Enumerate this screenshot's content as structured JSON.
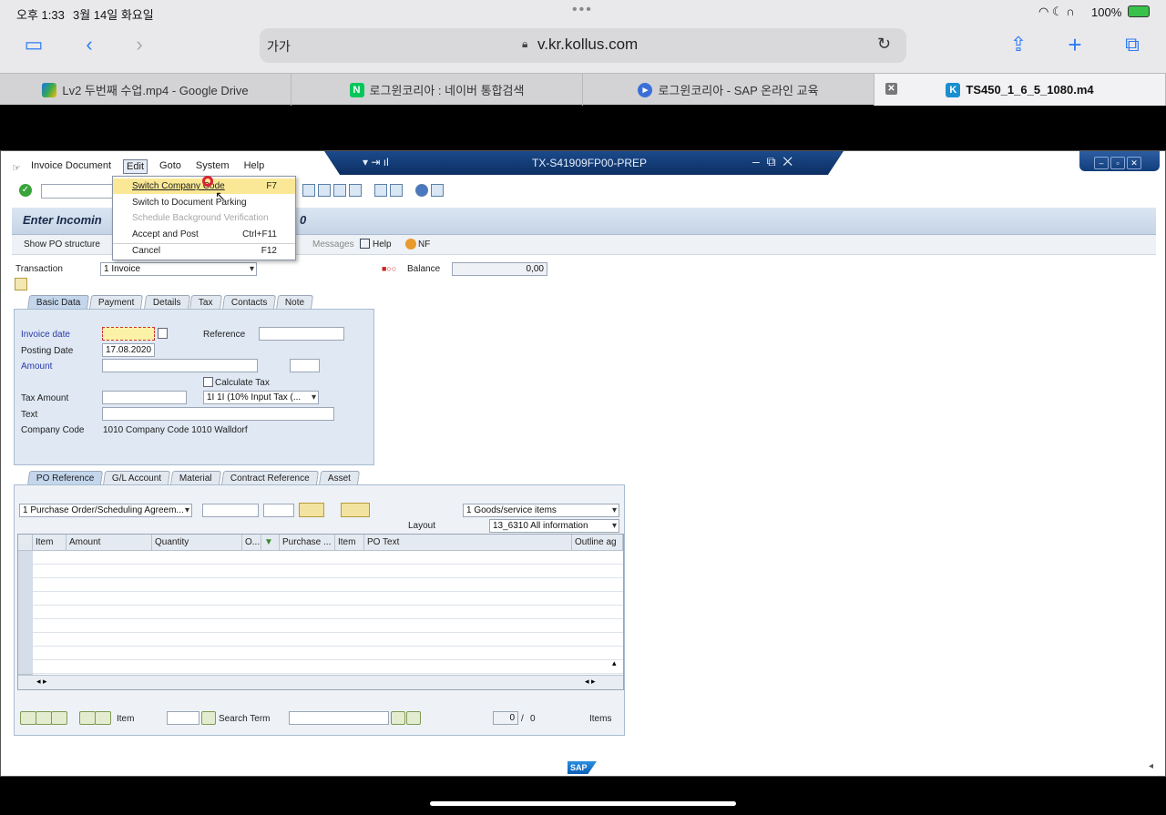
{
  "ipad": {
    "time": "오후 1:33",
    "date": "3월 14일 화요일",
    "battery": "100%",
    "aa_label": "가가",
    "url": "v.kr.kollus.com"
  },
  "browser_tabs": [
    {
      "label": "Lv2 두번째 수업.mp4 - Google Drive",
      "icon": "google-drive-icon"
    },
    {
      "label": "로그윈코리아 : 네이버 통합검색",
      "icon": "naver-icon"
    },
    {
      "label": "로그윈코리아 - SAP 온라인 교육",
      "icon": "play-icon"
    },
    {
      "label": "TS450_1_6_5_1080.m4",
      "icon": "kollus-icon"
    }
  ],
  "sap": {
    "menubar": [
      "Invoice Document",
      "Edit",
      "Goto",
      "System",
      "Help"
    ],
    "system_title": "TX-S41909FP00-PREP",
    "screen_title": "Enter Incomin",
    "screen_title_tail": "0",
    "app_toolbar": {
      "show_po": "Show PO structure",
      "messages": "Messages",
      "help": "Help",
      "nf": "NF"
    },
    "edit_menu": [
      {
        "label": "Switch Company Code",
        "shortcut": "F7"
      },
      {
        "label": "Switch to Document Parking",
        "shortcut": ""
      },
      {
        "label": "Schedule Background Verification",
        "shortcut": ""
      },
      {
        "label": "Accept and Post",
        "shortcut": "Ctrl+F11"
      },
      {
        "label": "Cancel",
        "shortcut": "F12"
      }
    ],
    "transaction_label": "Transaction",
    "transaction_value": "1 Invoice",
    "balance_label": "Balance",
    "balance_value": "0,00",
    "header_tabs": [
      "Basic Data",
      "Payment",
      "Details",
      "Tax",
      "Contacts",
      "Note"
    ],
    "basic": {
      "invoice_date_label": "Invoice date",
      "invoice_date_value": "",
      "reference_label": "Reference",
      "posting_date_label": "Posting Date",
      "posting_date_value": "17.08.2020",
      "amount_label": "Amount",
      "calc_tax_label": "Calculate Tax",
      "tax_amount_label": "Tax Amount",
      "tax_code_value": "1I 1I (10% Input Tax (...",
      "text_label": "Text",
      "company_code_label": "Company Code",
      "company_code_value": "1010 Company Code 1010 Walldorf"
    },
    "po_tabs": [
      "PO Reference",
      "G/L Account",
      "Material",
      "Contract Reference",
      "Asset"
    ],
    "po": {
      "ref_type": "1 Purchase Order/Scheduling Agreem...",
      "goods_select": "1 Goods/service items",
      "layout_label": "Layout",
      "layout_value": "13_6310 All information"
    },
    "grid_columns": [
      "Item",
      "Amount",
      "Quantity",
      "O...",
      "",
      "Purchase ...",
      "Item",
      "PO Text",
      "Outline ag"
    ],
    "bottom": {
      "item_label": "Item",
      "search_label": "Search Term",
      "count_value": "0",
      "count_sep": "/",
      "count_total": "0",
      "items_label": "Items"
    },
    "logo": "SAP"
  }
}
